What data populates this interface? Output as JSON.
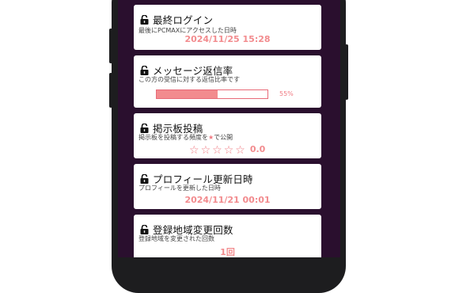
{
  "colors": {
    "accent": "#f28b8e",
    "frame": "#1d1d1f",
    "screen_bg": "#2a0f2e"
  },
  "cards": [
    {
      "title": "最終ログイン",
      "subtitle": "最後にPCMAXにアクセスした日時",
      "value": "2024/11/25 15:28",
      "icon": "lock-open-icon"
    },
    {
      "title": "メッセージ返信率",
      "subtitle": "この方の受信に対する返信比率です",
      "progress": 0.55,
      "progress_label": "55%",
      "icon": "lock-open-icon"
    },
    {
      "title": "掲示板投稿",
      "subtitle_before": "掲示板を投稿する頻度を",
      "subtitle_after": "で公開",
      "stars_total": 5,
      "stars_filled": 0,
      "rating": "0.0",
      "icon": "lock-open-icon"
    },
    {
      "title": "プロフィール更新日時",
      "subtitle": "プロフィールを更新した日時",
      "value": "2024/11/21 00:01",
      "icon": "lock-open-icon"
    },
    {
      "title": "登録地域変更回数",
      "subtitle": "登録地域を変更された回数",
      "value": "1回",
      "icon": "lock-open-icon"
    }
  ]
}
